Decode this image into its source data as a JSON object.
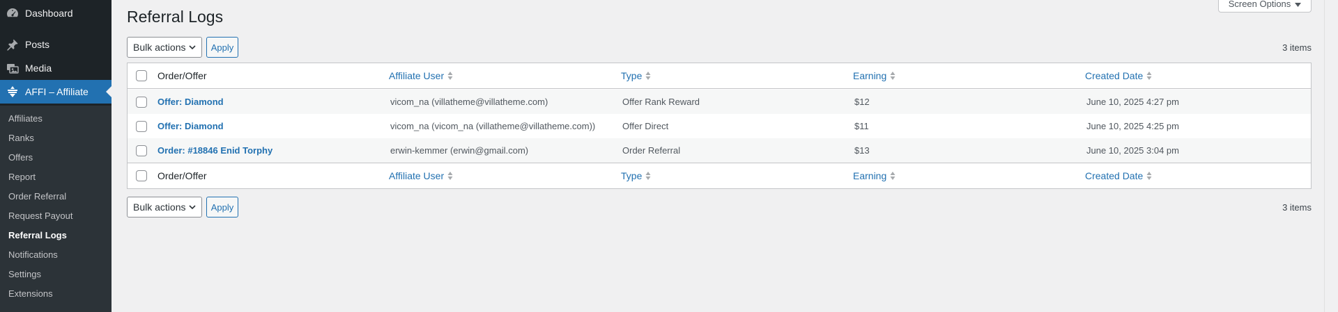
{
  "sidebar": {
    "top_items": [
      {
        "label": "Dashboard",
        "icon": "dashboard-icon"
      },
      {
        "label": "Posts",
        "icon": "pin-icon"
      },
      {
        "label": "Media",
        "icon": "media-icon"
      },
      {
        "label": "AFFI – Affiliate",
        "icon": "affiliate-icon"
      }
    ],
    "submenu": [
      "Affiliates",
      "Ranks",
      "Offers",
      "Report",
      "Order Referral",
      "Request Payout",
      "Referral Logs",
      "Notifications",
      "Settings",
      "Extensions"
    ],
    "current": "Referral Logs"
  },
  "header": {
    "screen_options": "Screen Options",
    "title": "Referral Logs"
  },
  "tablenav": {
    "bulk_actions": "Bulk actions",
    "apply": "Apply",
    "items_count": "3 items"
  },
  "table": {
    "columns": [
      "Order/Offer",
      "Affiliate User",
      "Type",
      "Earning",
      "Created Date"
    ],
    "rows": [
      {
        "order": "Offer: Diamond",
        "affiliate": "vicom_na (villatheme@villatheme.com)",
        "type": "Offer Rank Reward",
        "earning": "$12",
        "date": "June 10, 2025 4:27 pm"
      },
      {
        "order": "Offer: Diamond",
        "affiliate": "vicom_na (vicom_na (villatheme@villatheme.com))",
        "type": "Offer Direct",
        "earning": "$11",
        "date": "June 10, 2025 4:25 pm"
      },
      {
        "order": "Order: #18846 Enid Torphy",
        "affiliate": "erwin-kemmer (erwin@gmail.com)",
        "type": "Order Referral",
        "earning": "$13",
        "date": "June 10, 2025 3:04 pm"
      }
    ]
  },
  "colors": {
    "sidebar_bg": "#1d2327",
    "submenu_bg": "#2c3338",
    "accent": "#2271b1",
    "page_bg": "#f0f0f1"
  }
}
